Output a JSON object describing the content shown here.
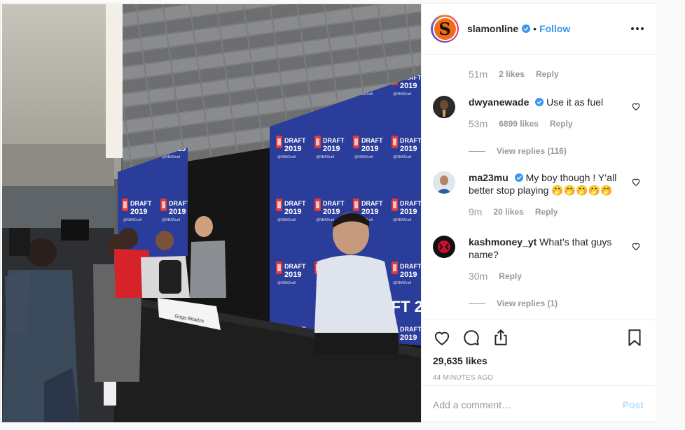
{
  "header": {
    "username": "slamonline",
    "separator": "•",
    "follow_label": "Follow",
    "avatar_letter": "S"
  },
  "first_meta": {
    "time": "51m",
    "likes": "2 likes",
    "reply": "Reply"
  },
  "comments": [
    {
      "username": "dwyanewade",
      "verified": true,
      "text": "Use it as fuel",
      "time": "53m",
      "likes": "6899 likes",
      "reply": "Reply",
      "view_replies": "View replies (116)"
    },
    {
      "username": "ma23mu",
      "verified": true,
      "text": "My boy though ! Y’all better stop playing 🤭🤭🤭🤭🤭",
      "time": "9m",
      "likes": "20 likes",
      "reply": "Reply"
    },
    {
      "username": "kashmoney_yt",
      "verified": false,
      "text": "What’s that guys name?",
      "time": "30m",
      "reply": "Reply",
      "view_replies": "View replies (1)"
    }
  ],
  "actions": {
    "likes_count": "29,635 likes",
    "time_ago": "44 MINUTES AGO"
  },
  "add_comment": {
    "placeholder": "Add a comment…",
    "post_label": "Post"
  },
  "photo": {
    "backdrop_text": "DRAFT 2019",
    "nameplate": "Goga Bitadze"
  },
  "colors": {
    "link_blue": "#3897f0",
    "post_disabled": "#b2dffc",
    "meta_gray": "#999999",
    "brand_orange": "#f36b12",
    "backdrop_blue": "#2d3f9e"
  }
}
